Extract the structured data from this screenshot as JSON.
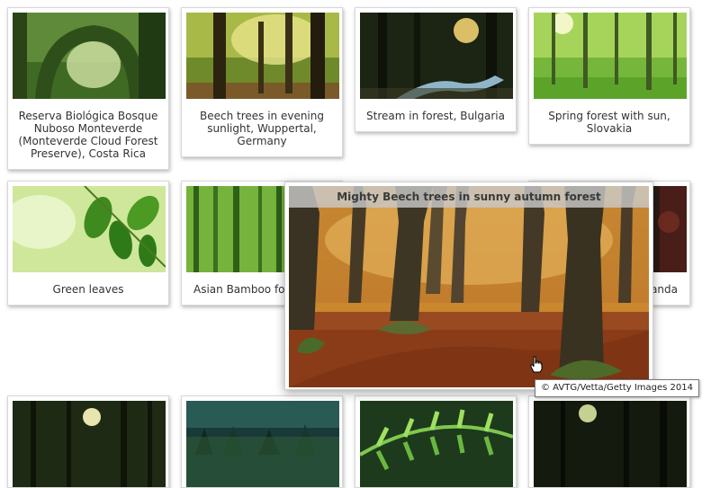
{
  "gallery": {
    "items": [
      {
        "caption": "Reserva Biológica Bosque Nuboso Monteverde (Monteverde Cloud Forest Preserve), Costa Rica",
        "image": "misty-green-forest-arch"
      },
      {
        "caption": "Beech trees in evening sunlight, Wuppertal, Germany",
        "image": "sunlit-beech-trees"
      },
      {
        "caption": "Stream in forest, Bulgaria",
        "image": "dark-forest-stream"
      },
      {
        "caption": "Spring forest with sun, Slovakia",
        "image": "bright-green-spring-forest"
      },
      {
        "caption": "Green leaves",
        "image": "green-leaves-closeup"
      },
      {
        "caption": "Asian Bamboo fore",
        "image": "bamboo-forest"
      },
      {
        "caption": "ganda",
        "image": "dark-red-forest"
      },
      {
        "caption": "",
        "image": "forest-path-sunrise"
      },
      {
        "caption": "",
        "image": "pine-forest-aerial"
      },
      {
        "caption": "",
        "image": "fern-fronds"
      },
      {
        "caption": "",
        "image": "dark-forest-sunbeam"
      }
    ]
  },
  "preview": {
    "title": "Mighty Beech trees in sunny autumn forest",
    "image": "autumn-beech-forest",
    "credit": "© AVTG/Vetta/Getty Images 2014"
  },
  "cursor": "hand-pointer-icon"
}
